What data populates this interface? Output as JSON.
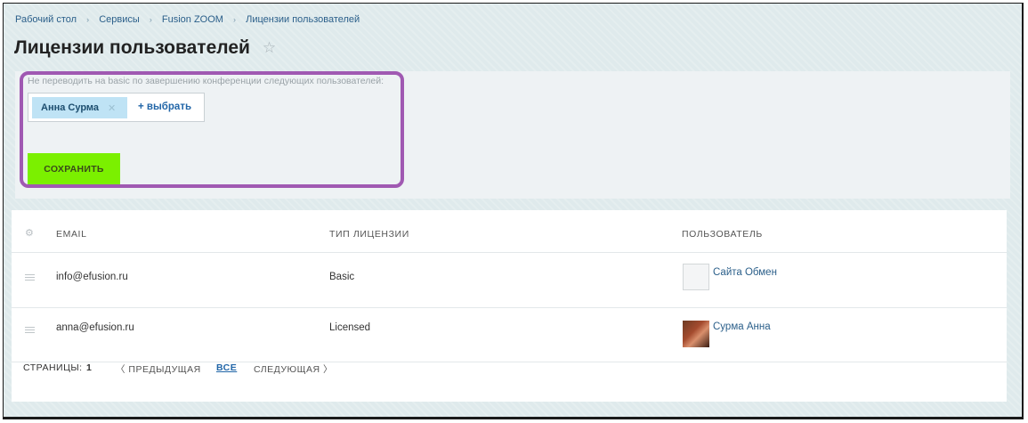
{
  "breadcrumb": {
    "items": [
      "Рабочий стол",
      "Сервисы",
      "Fusion ZOOM",
      "Лицензии пользователей"
    ],
    "separator": "›"
  },
  "page": {
    "title": "Лицензии пользователей",
    "favorite_icon": "star-icon"
  },
  "settings": {
    "hint": "Не переводить на basic по завершению конференции следующих пользователей:",
    "selected_users": [
      "Анна Сурма"
    ],
    "add_label": "+ выбрать",
    "save_label": "СОХРАНИТЬ"
  },
  "table": {
    "settings_icon": "gear-icon",
    "columns": [
      "EMAIL",
      "ТИП ЛИЦЕНЗИИ",
      "ПОЛЬЗОВАТЕЛЬ"
    ],
    "rows": [
      {
        "email": "info@efusion.ru",
        "license": "Basic",
        "user": "Сайта Обмен",
        "avatar": "default-avatar"
      },
      {
        "email": "anna@efusion.ru",
        "license": "Licensed",
        "user": "Сурма Анна",
        "avatar": "photo-avatar"
      }
    ]
  },
  "pagination": {
    "pages_label": "СТРАНИЦЫ:",
    "current_page": "1",
    "prev_label": "〈 ПРЕДЫДУЩАЯ",
    "all_label": "ВСЕ",
    "next_label": "СЛЕДУЮЩАЯ 〉"
  },
  "colors": {
    "background": "#dfeaec",
    "accent_link": "#2266a8",
    "save_button": "#7bf000",
    "chip": "#bfe3f5",
    "highlight_outline": "#a059b2"
  }
}
